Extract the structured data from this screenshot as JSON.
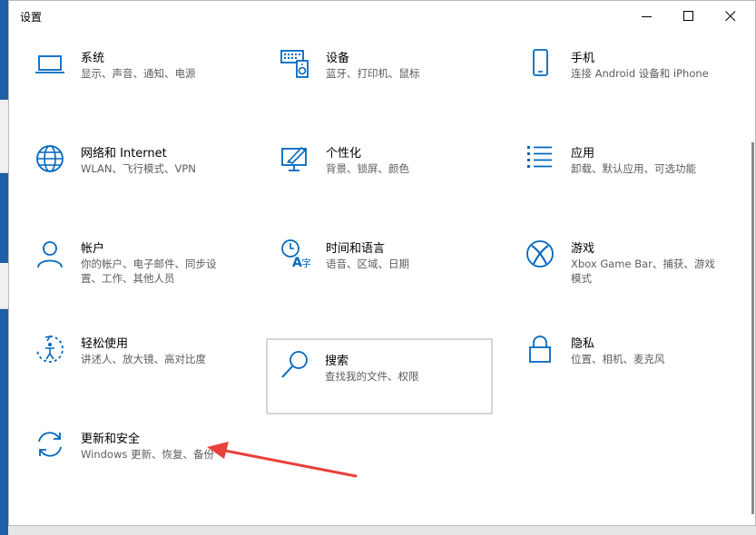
{
  "window": {
    "title": "设置"
  },
  "tiles": [
    {
      "label": "系统",
      "desc": "显示、声音、通知、电源",
      "icon": "laptop-icon"
    },
    {
      "label": "设备",
      "desc": "蓝牙、打印机、鼠标",
      "icon": "keyboard-speaker-icon"
    },
    {
      "label": "手机",
      "desc": "连接 Android 设备和 iPhone",
      "icon": "phone-icon"
    },
    {
      "label": "网络和 Internet",
      "desc": "WLAN、飞行模式、VPN",
      "icon": "globe-icon"
    },
    {
      "label": "个性化",
      "desc": "背景、锁屏、颜色",
      "icon": "paint-monitor-icon"
    },
    {
      "label": "应用",
      "desc": "卸载、默认应用、可选功能",
      "icon": "app-list-icon"
    },
    {
      "label": "帐户",
      "desc": "你的帐户、电子邮件、同步设置、工作、其他人员",
      "icon": "person-icon"
    },
    {
      "label": "时间和语言",
      "desc": "语音、区域、日期",
      "icon": "time-language-icon"
    },
    {
      "label": "游戏",
      "desc": "Xbox Game Bar、捕获、游戏模式",
      "icon": "xbox-icon"
    },
    {
      "label": "轻松使用",
      "desc": "讲述人、放大镜、高对比度",
      "icon": "ease-of-access-icon"
    },
    {
      "label": "搜索",
      "desc": "查找我的文件、权限",
      "icon": "search-icon"
    },
    {
      "label": "隐私",
      "desc": "位置、相机、麦克风",
      "icon": "lock-icon"
    },
    {
      "label": "更新和安全",
      "desc": "Windows 更新、恢复、备份",
      "icon": "update-sync-icon"
    }
  ],
  "colors": {
    "accent": "#0067c0",
    "annotation_arrow": "#e8403b"
  }
}
